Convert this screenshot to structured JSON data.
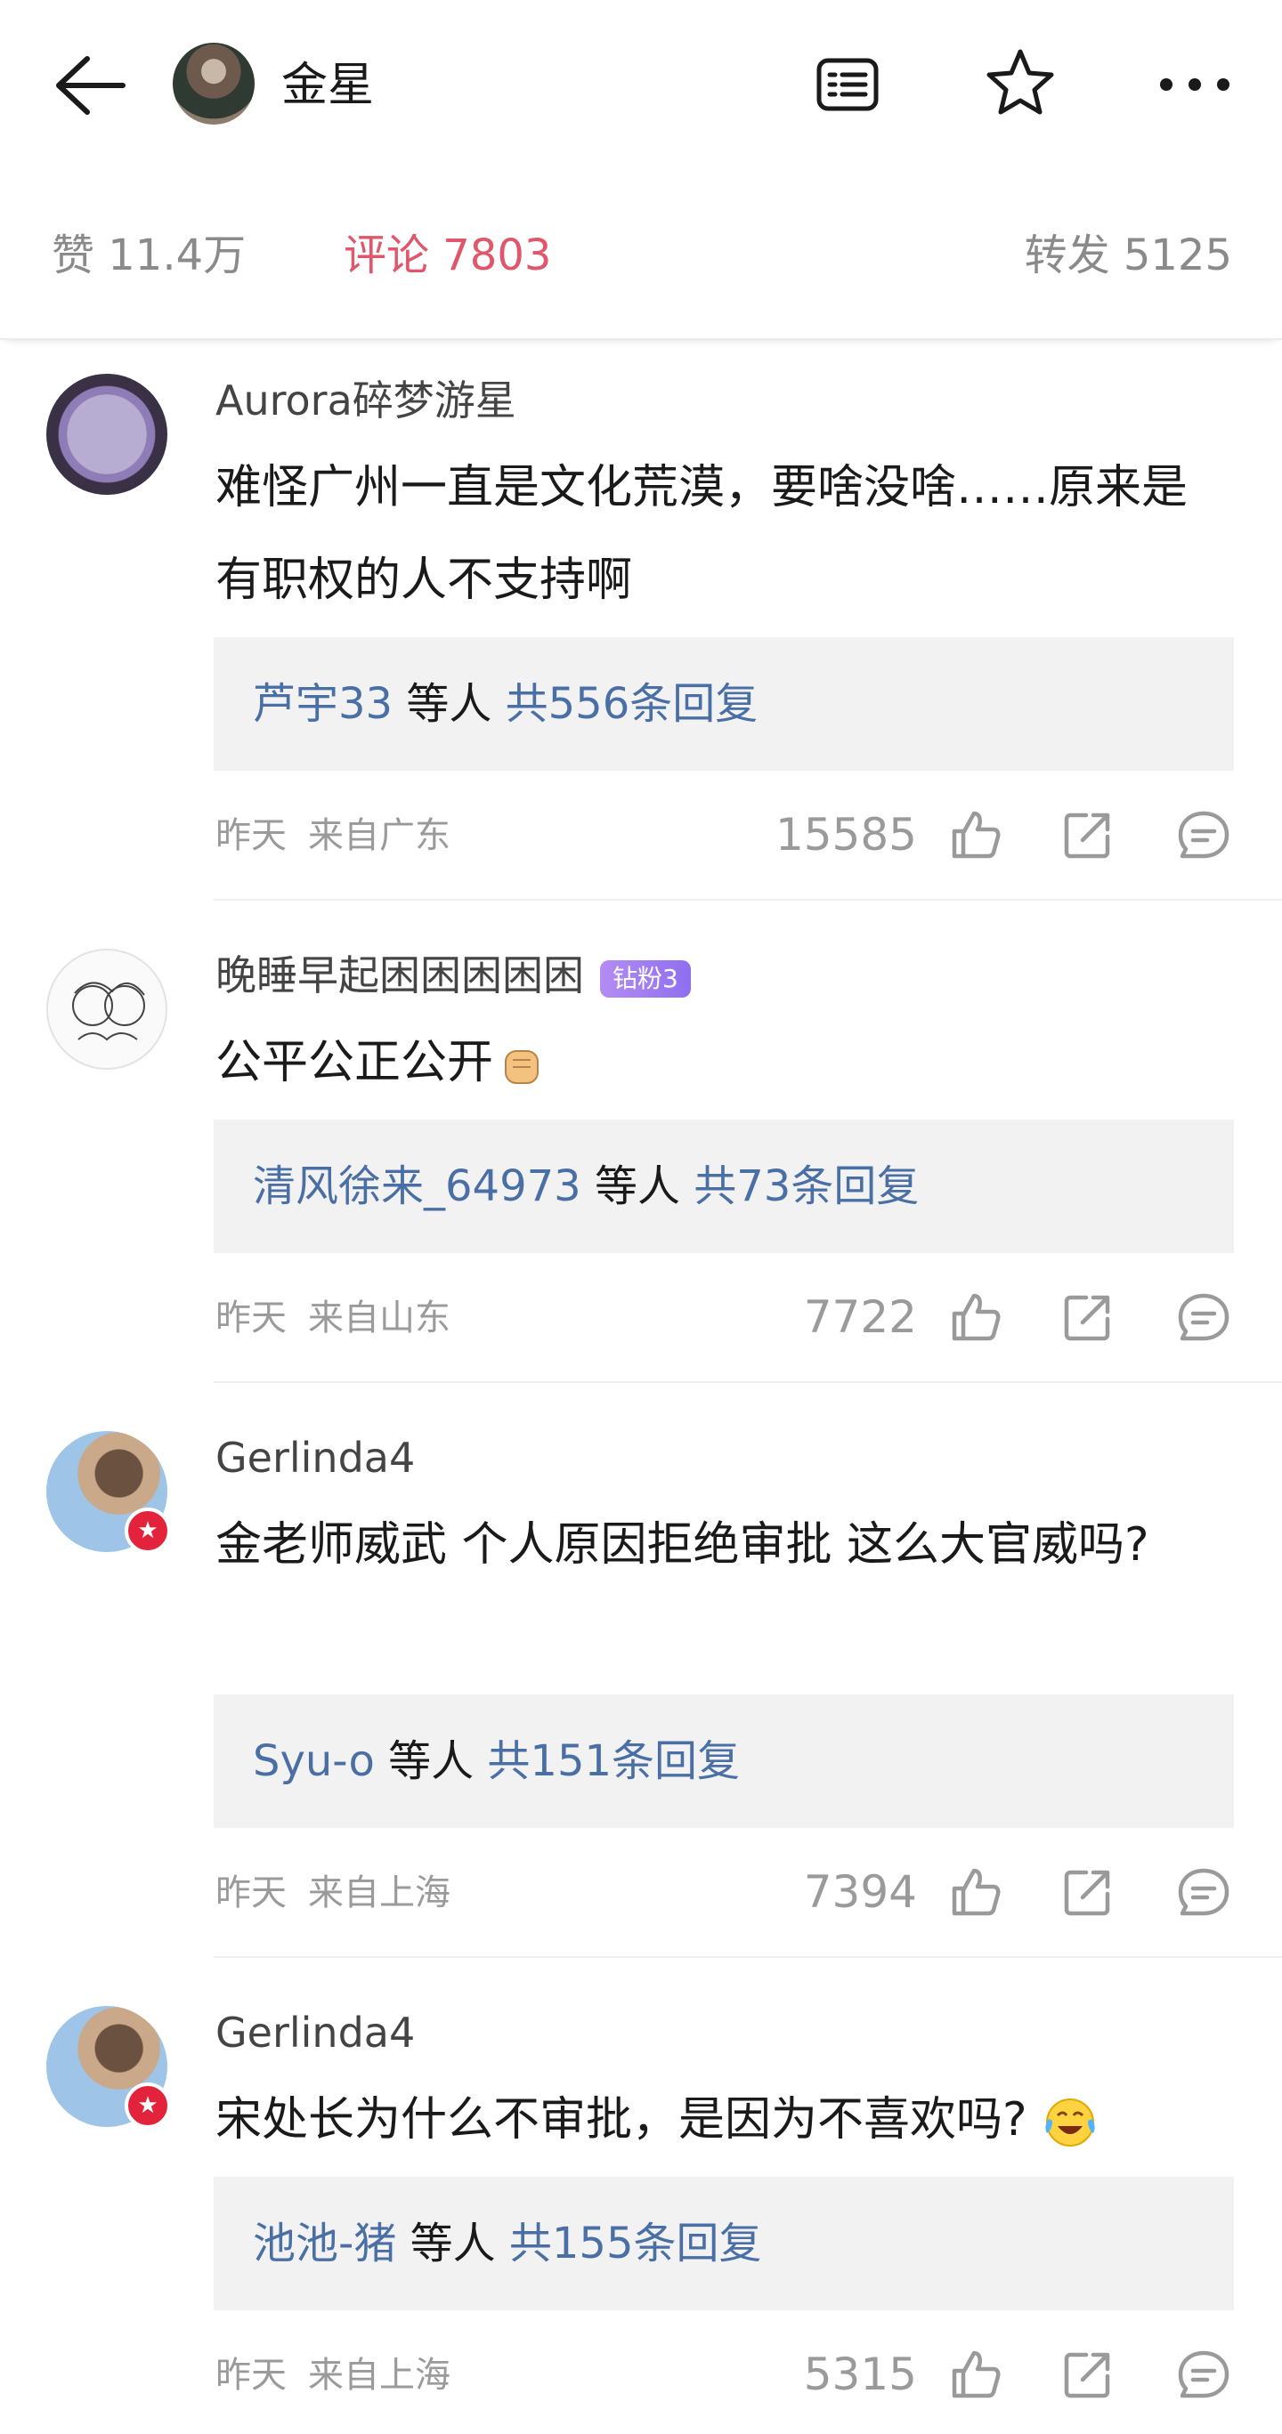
{
  "header": {
    "title": "金星",
    "icons": [
      "back-arrow-icon",
      "list-icon",
      "star-icon",
      "more-icon"
    ]
  },
  "tabs": {
    "likes": "赞 11.4万",
    "comments": "评论 7803",
    "reposts": "转发 5125",
    "active_color": "#e0566a"
  },
  "comments": [
    {
      "user": "Aurora碎梦游星",
      "text": "难怪广州一直是文化荒漠，要啥没啥……原来是有职权的人不支持啊",
      "reply_user": "芦宇33",
      "reply_middle": " 等人 ",
      "reply_total": "共556条回复",
      "time": "昨天",
      "location": "来自广东",
      "likes": "15585"
    },
    {
      "user": "晚睡早起困困困困困",
      "badge": "钻粉3",
      "text": "公平公正公开",
      "reply_user": "清风徐来_64973",
      "reply_middle": " 等人 ",
      "reply_total": "共73条回复",
      "time": "昨天",
      "location": "来自山东",
      "likes": "7722"
    },
    {
      "user": "Gerlinda4",
      "text": "金老师威武 个人原因拒绝审批 这么大官威吗?",
      "reply_user": "Syu-o",
      "reply_middle": " 等人 ",
      "reply_total": "共151条回复",
      "time": "昨天",
      "location": "来自上海",
      "likes": "7394"
    },
    {
      "user": "Gerlinda4",
      "text": "宋处长为什么不审批，是因为不喜欢吗?",
      "reply_user": "池池-猪",
      "reply_middle": " 等人 ",
      "reply_total": "共155条回复",
      "time": "昨天",
      "location": "来自上海",
      "likes": "5315"
    }
  ],
  "colors": {
    "link_blue": "#4a6fa5",
    "reply_bg": "#f2f2f2",
    "meta_gray": "#9a9a9a",
    "verified_red": "#e2233b"
  }
}
